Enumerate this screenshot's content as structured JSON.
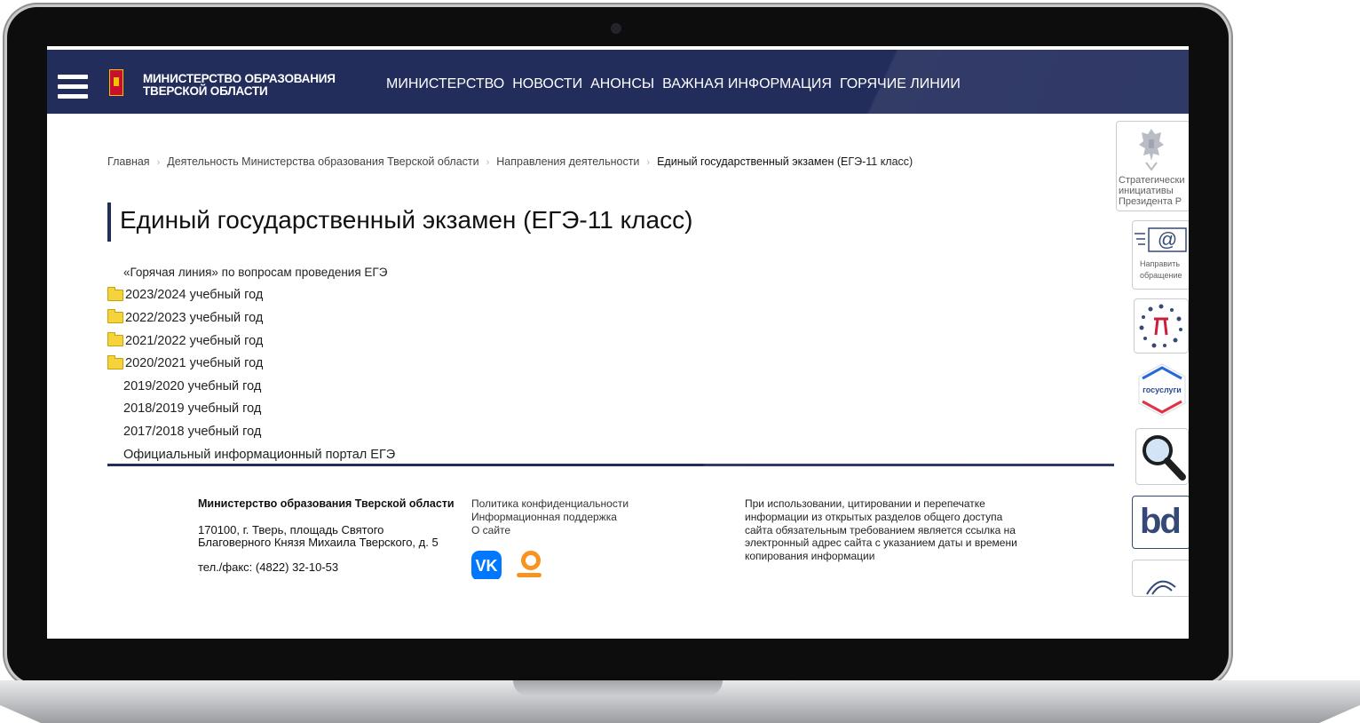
{
  "header": {
    "ministry_line1": "МИНИСТЕРСТВО ОБРАЗОВАНИЯ",
    "ministry_line2": "ТВЕРСКОЙ ОБЛАСТИ",
    "nav": [
      "МИНИСТЕРСТВО",
      "НОВОСТИ",
      "АНОНСЫ",
      "ВАЖНАЯ ИНФОРМАЦИЯ",
      "ГОРЯЧИЕ ЛИНИИ"
    ],
    "color": "#232d5c"
  },
  "breadcrumb": {
    "items": [
      "Главная",
      "Деятельность Министерства образования Тверской области",
      "Направления деятельности"
    ],
    "current": "Единый государственный экзамен (ЕГЭ-11 класс)"
  },
  "page": {
    "title": "Единый государственный экзамен (ЕГЭ-11 класс)"
  },
  "list": [
    {
      "label": "«Горячая линия» по вопросам проведения ЕГЭ",
      "folder": false
    },
    {
      "label": "2023/2024 учебный год",
      "folder": true
    },
    {
      "label": "2022/2023 учебный год",
      "folder": true
    },
    {
      "label": "2021/2022 учебный год",
      "folder": true
    },
    {
      "label": "2020/2021 учебный год",
      "folder": true
    },
    {
      "label": "2019/2020 учебный год",
      "folder": false
    },
    {
      "label": "2018/2019 учебный год",
      "folder": false
    },
    {
      "label": "2017/2018 учебный год",
      "folder": false
    },
    {
      "label": "Официальный информационный портал ЕГЭ",
      "folder": false
    }
  ],
  "footer": {
    "org_name": "Министерство образования Тверской области",
    "address_line1": "170100, г. Тверь, площадь Святого",
    "address_line2": "Благоверного Князя Михаила Тверского, д. 5",
    "phone": "тел./факс: (4822) 32-10-53",
    "links": [
      "Политика конфиденциальности",
      "Информационная поддержка",
      "О сайте"
    ],
    "vk_label": "VK",
    "copyright": "При использовании, цитировании и перепечатке информации из открытых разделов общего доступа сайта обязательным требованием является ссылка на электронный адрес сайта с указанием даты и времени копирования информации"
  },
  "widgets": {
    "strategic": [
      "Стратегически",
      "инициативы",
      "Президента Р"
    ],
    "mail": [
      "Направить",
      "обращение"
    ],
    "gosuslugi": "госуслуги",
    "bd": "bd"
  }
}
